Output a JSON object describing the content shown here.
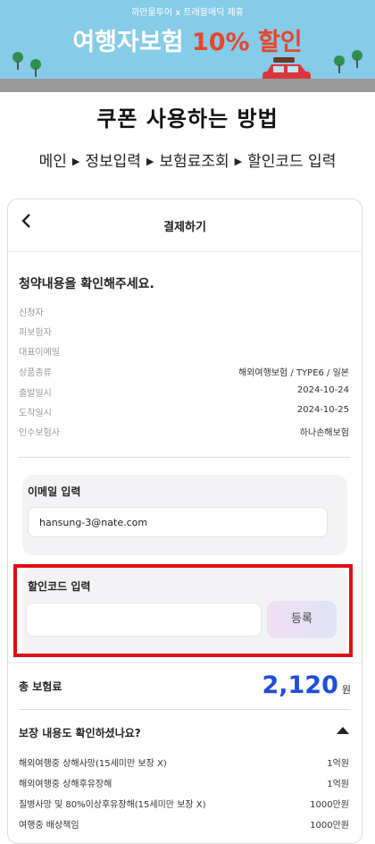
{
  "banner": {
    "subtitle": "까만물투어 x 트래블메딕 제휴",
    "title_main": "여행자보험 ",
    "title_highlight": "10% 할인",
    "colors": {
      "sky": "#86cbe8",
      "highlight": "#e8452c",
      "car": "#d9373c"
    }
  },
  "page_heading": "쿠폰 사용하는 방법",
  "steps": [
    "메인",
    "정보입력",
    "보험료조회",
    "할인코드 입력"
  ],
  "phone": {
    "topbar": {
      "back_icon": "chevron-left-icon",
      "title": "결제하기"
    },
    "section_title": "청약내용을 확인해주세요.",
    "info_rows": [
      {
        "label": "신청자",
        "value": ""
      },
      {
        "label": "피보험자",
        "value": ""
      },
      {
        "label": "대표이메일",
        "value": ""
      },
      {
        "label": "상품종류",
        "value": "해외여행보험 / TYPE6 / 일본"
      },
      {
        "label": "출발일시",
        "value": "2024-10-24"
      },
      {
        "label": "도착일시",
        "value": "2024-10-25"
      },
      {
        "label": "인수보험사",
        "value": "하나손해보험"
      }
    ],
    "email": {
      "label": "이메일 입력",
      "value": "hansung-3@nate.com"
    },
    "promo": {
      "label": "할인코드 입력",
      "placeholder": "",
      "button_label": "등록",
      "highlight_color": "#e10d14"
    },
    "total": {
      "label": "총 보험료",
      "amount": "2,120",
      "unit": "원",
      "amount_color": "#1f4ed8"
    },
    "coverage": {
      "title": "보장 내용도 확인하셨나요?",
      "toggle_icon": "caret-up-icon",
      "rows": [
        {
          "label": "해외여행중 상해사망(15세미만 보장 X)",
          "value": "1억원"
        },
        {
          "label": "해외여행중 상해후유장해",
          "value": "1억원"
        },
        {
          "label": "질병사망 및 80%이상후유장해(15세미만 보장 X)",
          "value": "1000만원"
        },
        {
          "label": "여행중 배상책임",
          "value": "1000만원"
        }
      ]
    }
  }
}
